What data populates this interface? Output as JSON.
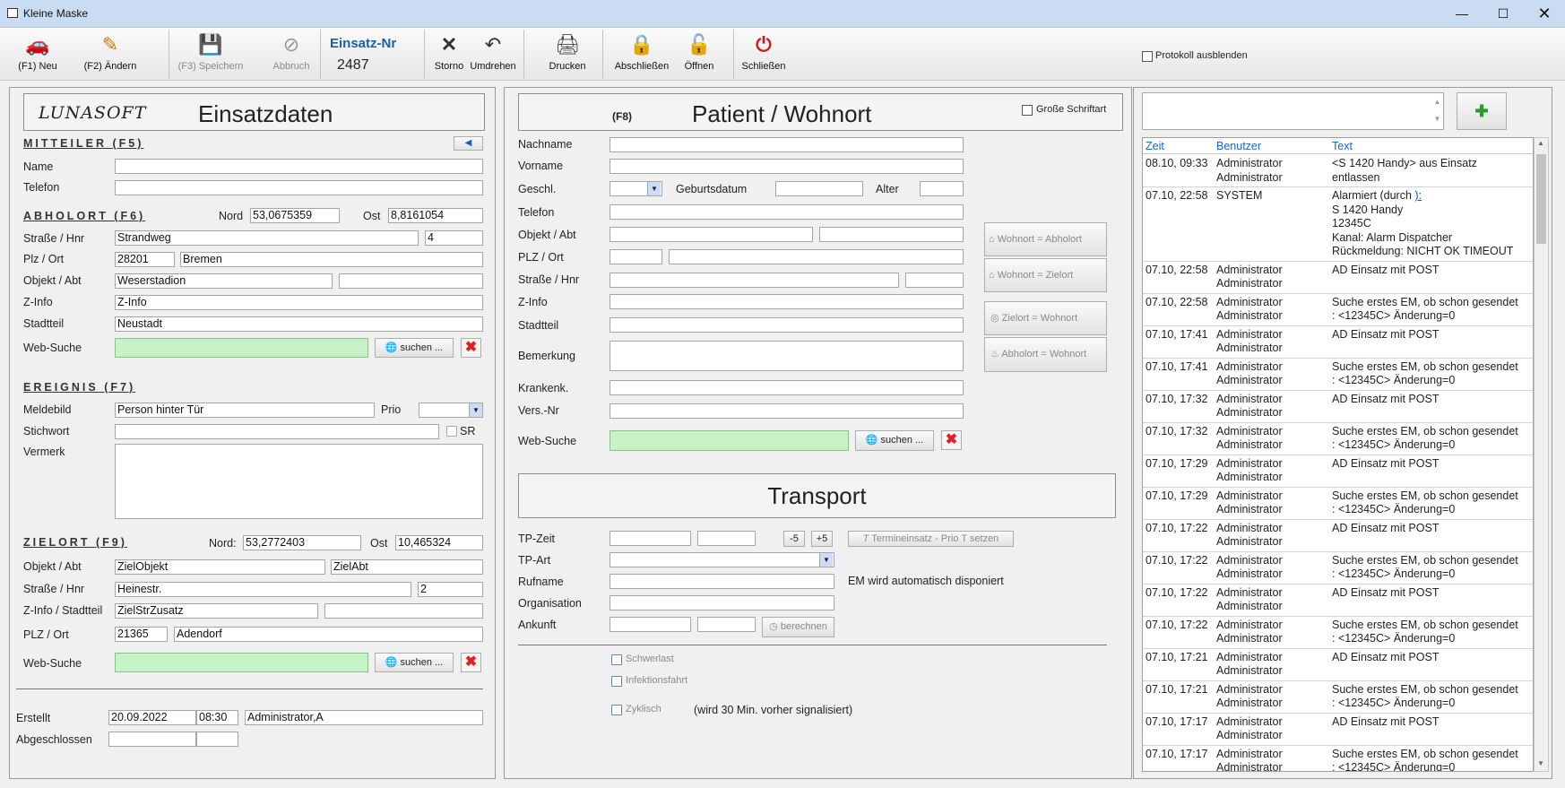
{
  "window": {
    "title": "Kleine Maske"
  },
  "toolbar": {
    "new": "(F1) Neu",
    "edit": "(F2) Ändern",
    "save": "(F3) Speichern",
    "abort": "Abbruch",
    "einsatz_nr_label": "Einsatz-Nr",
    "einsatz_nr": "2487",
    "storno": "Storno",
    "umdrehen": "Umdrehen",
    "drucken": "Drucken",
    "abschliessen": "Abschließen",
    "oeffnen": "Öffnen",
    "schliessen": "Schließen",
    "protokoll": "Protokoll ausblenden"
  },
  "left": {
    "logo": "LUNASOFT",
    "title": "Einsatzdaten",
    "mitteiler": {
      "header": "MITTEILER (F5)",
      "name_label": "Name",
      "name": "",
      "telefon_label": "Telefon",
      "telefon": ""
    },
    "abholort": {
      "header": "ABHOLORT (F6)",
      "nord_label": "Nord",
      "nord": "53,0675359",
      "ost_label": "Ost",
      "ost": "8,8161054",
      "strasse_label": "Straße / Hnr",
      "strasse": "Strandweg",
      "hnr": "4",
      "plz_label": "Plz / Ort",
      "plz": "28201",
      "ort": "Bremen",
      "objekt_label": "Objekt / Abt",
      "objekt": "Weserstadion",
      "abt": "",
      "zinfo_label": "Z-Info",
      "zinfo": "Z-Info",
      "stadtteil_label": "Stadtteil",
      "stadtteil": "Neustadt",
      "websuche_label": "Web-Suche",
      "suchen": "suchen ..."
    },
    "ereignis": {
      "header": "EREIGNIS (F7)",
      "meldebild_label": "Meldebild",
      "meldebild": "Person hinter Tür",
      "prio_label": "Prio",
      "stichwort_label": "Stichwort",
      "sr": "SR",
      "vermerk_label": "Vermerk"
    },
    "zielort": {
      "header": "ZIELORT (F9)",
      "nord_label": "Nord:",
      "nord": "53,2772403",
      "ost_label": "Ost",
      "ost": "10,465324",
      "objekt_label": "Objekt / Abt",
      "objekt": "ZielObjekt",
      "abt": "ZielAbt",
      "strasse_label": "Straße / Hnr",
      "strasse": "Heinestr.",
      "hnr": "2",
      "zinfo_label": "Z-Info / Stadtteil",
      "zinfo": "ZielStrZusatz",
      "plz_label": "PLZ / Ort",
      "plz": "21365",
      "ort": "Adendorf",
      "websuche_label": "Web-Suche",
      "suchen": "suchen ..."
    },
    "erstellt_label": "Erstellt",
    "erstellt_date": "20.09.2022",
    "erstellt_time": "08:30",
    "erstellt_user": "Administrator,A",
    "abgeschlossen_label": "Abgeschlossen"
  },
  "middle": {
    "f8": "(F8)",
    "title": "Patient / Wohnort",
    "grosse_schrift": "Große Schriftart",
    "nachname": "Nachname",
    "vorname": "Vorname",
    "geschl": "Geschl.",
    "geburtsdatum": "Geburtsdatum",
    "alter": "Alter",
    "telefon": "Telefon",
    "objekt": "Objekt / Abt",
    "plz": "PLZ / Ort",
    "strasse": "Straße / Hnr",
    "zinfo": "Z-Info",
    "stadtteil": "Stadtteil",
    "bemerkung": "Bemerkung",
    "krankenk": "Krankenk.",
    "versnr": "Vers.-Nr",
    "websuche": "Web-Suche",
    "suchen": "suchen ...",
    "btn_wohnort_abholort": "Wohnort = Abholort",
    "btn_wohnort_zielort": "Wohnort = Zielort",
    "btn_zielort_wohnort": "Zielort = Wohnort",
    "btn_abholort_wohnort": "Abholort = Wohnort",
    "transport": {
      "title": "Transport",
      "tpzeit": "TP-Zeit",
      "minus": "-5",
      "plus": "+5",
      "termin": "Termineinsatz - Prio T setzen",
      "tpart": "TP-Art",
      "rufname": "Rufname",
      "em_auto": "EM wird automatisch disponiert",
      "organisation": "Organisation",
      "ankunft": "Ankunft",
      "berechnen": "berechnen",
      "schwerlast": "Schwerlast",
      "infektion": "Infektionsfahrt",
      "zyklisch": "Zyklisch",
      "zyklisch_note": "(wird 30 Min. vorher signalisiert)"
    }
  },
  "right": {
    "columns": [
      "Zeit",
      "Benutzer",
      "Text"
    ],
    "rows": [
      {
        "zeit": "08.10, 09:33",
        "benutzer": "Administrator\nAdministrator",
        "text": "<S 1420 Handy> aus Einsatz\nentlassen"
      },
      {
        "zeit": "07.10, 22:58",
        "benutzer": "SYSTEM",
        "text": "Alarmiert (durch ",
        "link": "):",
        "text2": "S 1420 Handy\n12345C\nKanal: Alarm Dispatcher\nRückmeldung: NICHT OK TIMEOUT"
      },
      {
        "zeit": "07.10, 22:58",
        "benutzer": "Administrator\nAdministrator",
        "text": "AD Einsatz mit POST"
      },
      {
        "zeit": "07.10, 22:58",
        "benutzer": "Administrator\nAdministrator",
        "text": "Suche erstes EM, ob schon gesendet\n: <12345C> Änderung=0"
      },
      {
        "zeit": "07.10, 17:41",
        "benutzer": "Administrator\nAdministrator",
        "text": "AD Einsatz mit POST"
      },
      {
        "zeit": "07.10, 17:41",
        "benutzer": "Administrator\nAdministrator",
        "text": "Suche erstes EM, ob schon gesendet\n: <12345C> Änderung=0"
      },
      {
        "zeit": "07.10, 17:32",
        "benutzer": "Administrator\nAdministrator",
        "text": "AD Einsatz mit POST"
      },
      {
        "zeit": "07.10, 17:32",
        "benutzer": "Administrator\nAdministrator",
        "text": "Suche erstes EM, ob schon gesendet\n: <12345C> Änderung=0"
      },
      {
        "zeit": "07.10, 17:29",
        "benutzer": "Administrator\nAdministrator",
        "text": "AD Einsatz mit POST"
      },
      {
        "zeit": "07.10, 17:29",
        "benutzer": "Administrator\nAdministrator",
        "text": "Suche erstes EM, ob schon gesendet\n: <12345C> Änderung=0"
      },
      {
        "zeit": "07.10, 17:22",
        "benutzer": "Administrator\nAdministrator",
        "text": "AD Einsatz mit POST"
      },
      {
        "zeit": "07.10, 17:22",
        "benutzer": "Administrator\nAdministrator",
        "text": "Suche erstes EM, ob schon gesendet\n: <12345C> Änderung=0"
      },
      {
        "zeit": "07.10, 17:22",
        "benutzer": "Administrator\nAdministrator",
        "text": "AD Einsatz mit POST"
      },
      {
        "zeit": "07.10, 17:22",
        "benutzer": "Administrator\nAdministrator",
        "text": "Suche erstes EM, ob schon gesendet\n: <12345C> Änderung=0"
      },
      {
        "zeit": "07.10, 17:21",
        "benutzer": "Administrator\nAdministrator",
        "text": "AD Einsatz mit POST"
      },
      {
        "zeit": "07.10, 17:21",
        "benutzer": "Administrator\nAdministrator",
        "text": "Suche erstes EM, ob schon gesendet\n: <12345C> Änderung=0"
      },
      {
        "zeit": "07.10, 17:17",
        "benutzer": "Administrator\nAdministrator",
        "text": "AD Einsatz mit POST"
      },
      {
        "zeit": "07.10, 17:17",
        "benutzer": "Administrator\nAdministrator",
        "text": "Suche erstes EM, ob schon gesendet\n: <12345C> Änderung=0"
      }
    ]
  }
}
